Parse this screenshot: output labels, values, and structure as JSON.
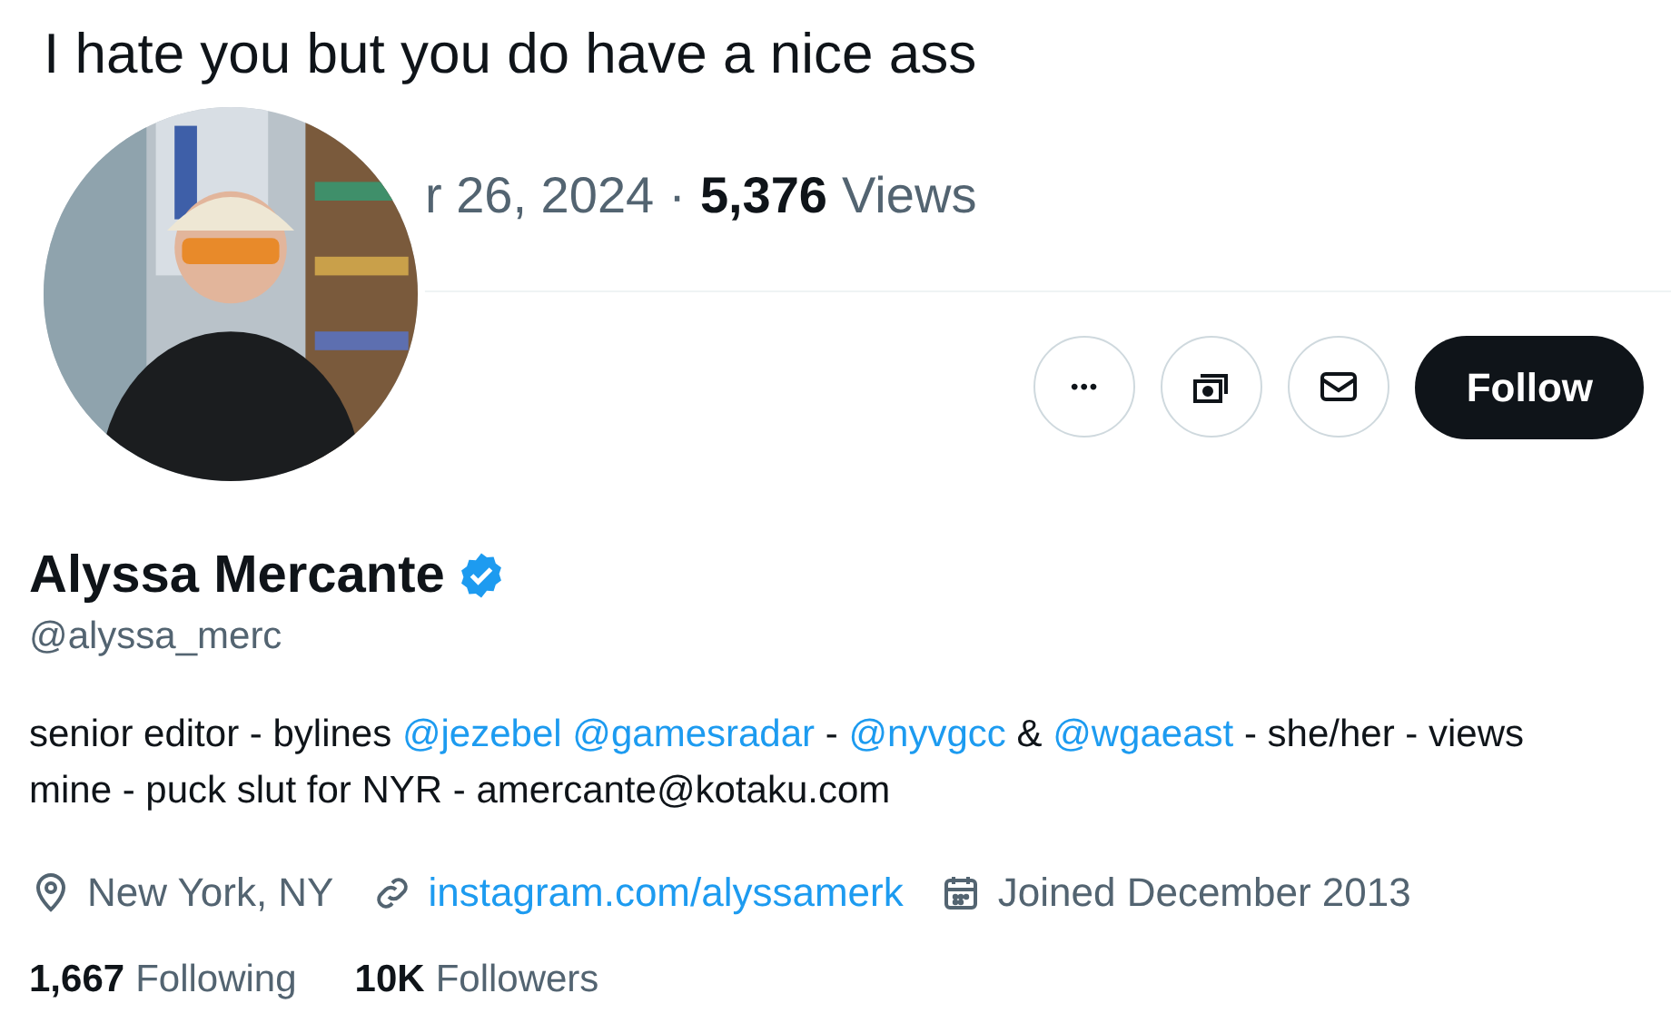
{
  "tweet": {
    "text": "I hate you but you do have a nice ass",
    "date": "r 26, 2024",
    "separator": "·",
    "views_count": "5,376",
    "views_label": "Views"
  },
  "actions": [
    {
      "kind": "more",
      "label": "•••"
    },
    {
      "kind": "money"
    },
    {
      "kind": "message"
    },
    {
      "kind": "follow",
      "label": "Follow"
    }
  ],
  "profile": {
    "name": "Alyssa Mercante",
    "verified": true,
    "handle": "@alyssa_merc",
    "bio": [
      {
        "kind": "text",
        "text": "senior editor - bylines "
      },
      {
        "kind": "mention",
        "text": "@jezebel"
      },
      {
        "kind": "space"
      },
      {
        "kind": "mention",
        "text": "@gamesradar"
      },
      {
        "kind": "text",
        "text": " - "
      },
      {
        "kind": "mention",
        "text": "@nyvgcc"
      },
      {
        "kind": "text",
        "text": " & "
      },
      {
        "kind": "mention",
        "text": "@wgaeast"
      },
      {
        "kind": "text",
        "text": " - she/her - views mine - puck slut for NYR - amercante@kotaku.com"
      }
    ],
    "meta": [
      {
        "kind": "location",
        "text": "New York, NY"
      },
      {
        "kind": "link",
        "text": "instagram.com/alyssamerk"
      },
      {
        "kind": "joined",
        "text": "Joined December 2013"
      }
    ],
    "stats": [
      {
        "count": "1,667",
        "label": "Following"
      },
      {
        "count": "10K",
        "label": "Followers"
      }
    ]
  }
}
